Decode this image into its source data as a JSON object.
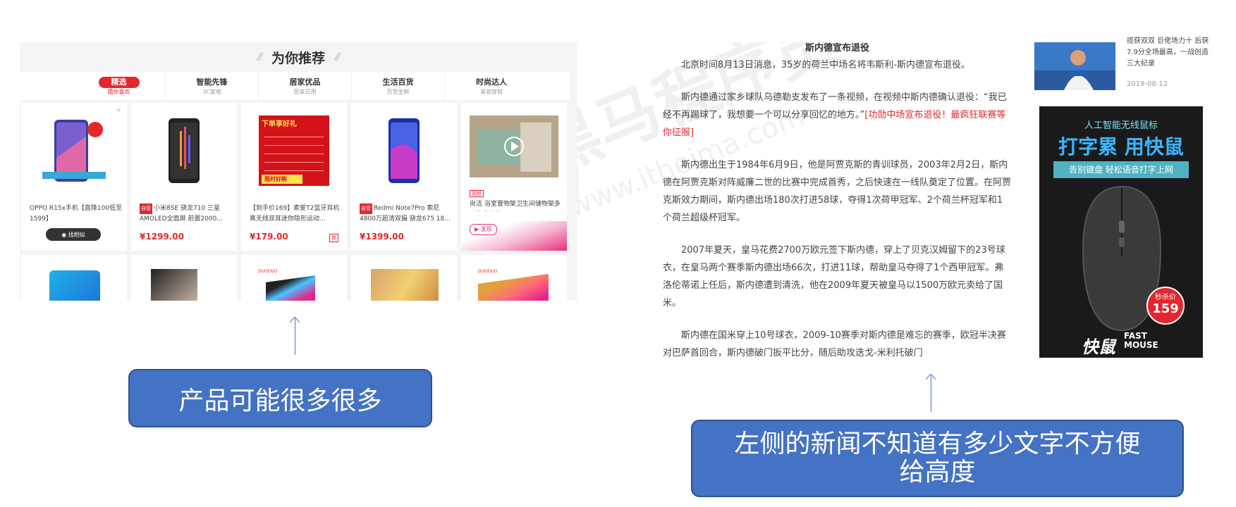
{
  "watermark": {
    "text": "黑马程序员 www.itheima.com"
  },
  "recommend": {
    "title": "为你推荐",
    "tabs": [
      {
        "name": "精选",
        "sub": "猜你喜欢"
      },
      {
        "name": "智能先锋",
        "sub": "3C家电"
      },
      {
        "name": "居家优品",
        "sub": "居家日用"
      },
      {
        "name": "生活百货",
        "sub": "百货生鲜"
      },
      {
        "name": "时尚达人",
        "sub": "美妆穿搭"
      }
    ],
    "products": [
      {
        "name": "OPPO R15x手机【直降100低至1599】",
        "button": "找相似"
      },
      {
        "tag": "自营",
        "name": "小米8SE 骁龙710 三星AMOLED全面屏 前置2000...",
        "price": "¥1299.00"
      },
      {
        "name": "【到手价169】索爱T2蓝牙耳机真无线双耳迷你隐形运动...",
        "price": "¥179.00",
        "badge": "券"
      },
      {
        "tag": "自营",
        "name": "Redmi Note7Pro 索尼4800万超清双摄 骁龙675 18...",
        "price": "¥1399.00"
      },
      {
        "video_tag": "视频",
        "name": "尚洁 浴室置物架卫生间储物架多功能收纳架",
        "button": "发现"
      }
    ],
    "promo": {
      "title": "下单享好礼",
      "foot": "限时好购"
    }
  },
  "callout_left": {
    "text": "产品可能很多很多"
  },
  "article": {
    "title": "斯内德宣布退役",
    "p1": "北京时间8月13日消息，35岁的荷兰中场名将韦斯利-斯内德宣布退役。",
    "p2": "斯内德通过家乡球队乌德勒支发布了一条视频，在视频中斯内德确认退役：“我已经不再踢球了，我想要一个可以分享回忆的地方。”",
    "p2_link": "[功勋中场宣布退役！最疯狂联赛等你征服]",
    "p3": "斯内德出生于1984年6月9日，他是阿贾克斯的青训球员，2003年2月2日，斯内德在阿贾克斯对阵威廉二世的比赛中完成首秀，之后快速在一线队奠定了位置。在阿贾克斯效力期间，斯内德出场180次打进58球，夺得1次荷甲冠军、2个荷兰杯冠军和1个荷兰超级杯冠军。",
    "p4": "2007年夏天，皇马花费2700万欧元签下斯内德，穿上了贝克汉姆留下的23号球衣，在皇马两个赛季斯内德出场66次，打进11球，帮助皇马夺得了1个西甲冠军。弗洛伦蒂诺上任后，斯内德遭到清洗，他在2009年夏天被皇马以1500万欧元卖给了国米。",
    "p5": "斯内德在国米穿上10号球衣，2009-10赛季对斯内德是难忘的赛季，欧冠半决赛对巴萨首回合，斯内德破门扳平比分，随后助攻迭戈-米利托破门"
  },
  "sidebar": {
    "news_text": "揽获双双 巨佬场力十 后获7.9分全场最高，一战创造三大纪录",
    "news_date": "2019-08-12",
    "ad": {
      "top": "人工智能无线鼠标",
      "big": "打字累 用快鼠",
      "band": "告别键盘 轻松语音打字上网",
      "price_label": "秒杀价",
      "price": "159",
      "brand": "快鼠",
      "brand_en": "FAST MOUSE"
    }
  },
  "callout_right": {
    "line1": "左侧的新闻不知道有多少文字不方便",
    "line2": "给高度"
  },
  "colors": {
    "accent": "#e4262d",
    "callout": "#4472c4",
    "callout_border": "#2f528f"
  }
}
